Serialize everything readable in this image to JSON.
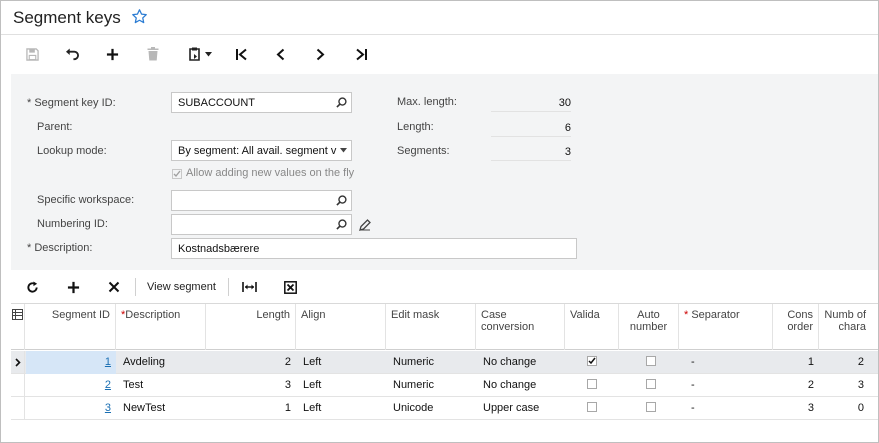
{
  "page": {
    "title": "Segment keys"
  },
  "form": {
    "segment_key_id_label": "Segment key ID:",
    "segment_key_id_value": "SUBACCOUNT",
    "parent_label": "Parent:",
    "lookup_mode_label": "Lookup mode:",
    "lookup_mode_value": "By segment: All avail. segment v",
    "allow_new_values_label": "Allow adding new values on the fly",
    "specific_workspace_label": "Specific workspace:",
    "specific_workspace_value": "",
    "numbering_id_label": "Numbering ID:",
    "numbering_id_value": "",
    "description_label": "Description:",
    "description_value": "Kostnadsbærere",
    "max_length_label": "Max. length:",
    "max_length_value": "30",
    "length_label": "Length:",
    "length_value": "6",
    "segments_label": "Segments:",
    "segments_value": "3",
    "required_mark": "*"
  },
  "grid_toolbar": {
    "view_segment_label": "View segment"
  },
  "grid": {
    "headers": {
      "segment_id": "Segment ID",
      "description": "Description",
      "length": "Length",
      "align": "Align",
      "edit_mask": "Edit mask",
      "case_conversion": "Case conversion",
      "validate": "Valida",
      "auto_number": "Auto number",
      "separator": "Separator",
      "cons_order": "Cons order",
      "num_chars": "Numb of chara",
      "required_mark": "*"
    },
    "rows": [
      {
        "segment_id": "1",
        "description": "Avdeling",
        "length": "2",
        "align": "Left",
        "edit_mask": "Numeric",
        "case_conversion": "No change",
        "validate": true,
        "auto_number": false,
        "separator": "-",
        "cons_order": "1",
        "num_chars": "2"
      },
      {
        "segment_id": "2",
        "description": "Test",
        "length": "3",
        "align": "Left",
        "edit_mask": "Numeric",
        "case_conversion": "No change",
        "validate": false,
        "auto_number": false,
        "separator": "-",
        "cons_order": "2",
        "num_chars": "3"
      },
      {
        "segment_id": "3",
        "description": "NewTest",
        "length": "1",
        "align": "Left",
        "edit_mask": "Unicode",
        "case_conversion": "Upper case",
        "validate": false,
        "auto_number": false,
        "separator": "-",
        "cons_order": "3",
        "num_chars": "0"
      }
    ]
  },
  "colors": {
    "accent": "#1a6fb3",
    "form_bg": "#f3f4f5",
    "selected_row": "#e8eaed",
    "active_cell": "#d6e6f7",
    "required": "#c00000"
  }
}
